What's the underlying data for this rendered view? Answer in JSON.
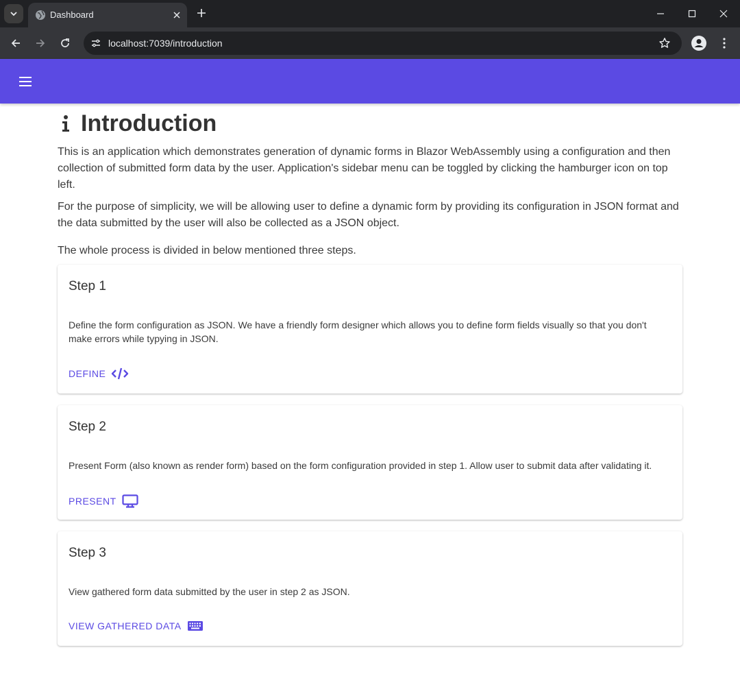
{
  "browser": {
    "tab_title": "Dashboard",
    "url": "localhost:7039/introduction"
  },
  "page": {
    "title": "Introduction",
    "paragraphs": [
      "This is an application which demonstrates generation of dynamic forms in Blazor WebAssembly using a configuration and then collection of submitted form data by the user. Application's sidebar menu can be toggled by clicking the hamburger icon on top left.",
      "For the purpose of simplicity, we will be allowing user to define a dynamic form by providing its configuration in JSON format and the data submitted by the user will also be collected as a JSON object.",
      "The whole process is divided in below mentioned three steps."
    ]
  },
  "steps": [
    {
      "title": "Step 1",
      "body": "Define the form configuration as JSON. We have a friendly form designer which allows you to define form fields visually so that you don't make errors while typying in JSON.",
      "action": "Define",
      "icon": "code-icon"
    },
    {
      "title": "Step 2",
      "body": "Present Form (also known as render form) based on the form configuration provided in step 1. Allow user to submit data after validating it.",
      "action": "Present",
      "icon": "desktop-icon"
    },
    {
      "title": "Step 3",
      "body": "View gathered form data submitted by the user in step 2 as JSON.",
      "action": "View gathered data",
      "icon": "keyboard-icon"
    }
  ],
  "colors": {
    "appbar": "#5b4ae3",
    "accent": "#5b4ae3",
    "chrome_dark": "#202124",
    "chrome_mid": "#35363a"
  }
}
